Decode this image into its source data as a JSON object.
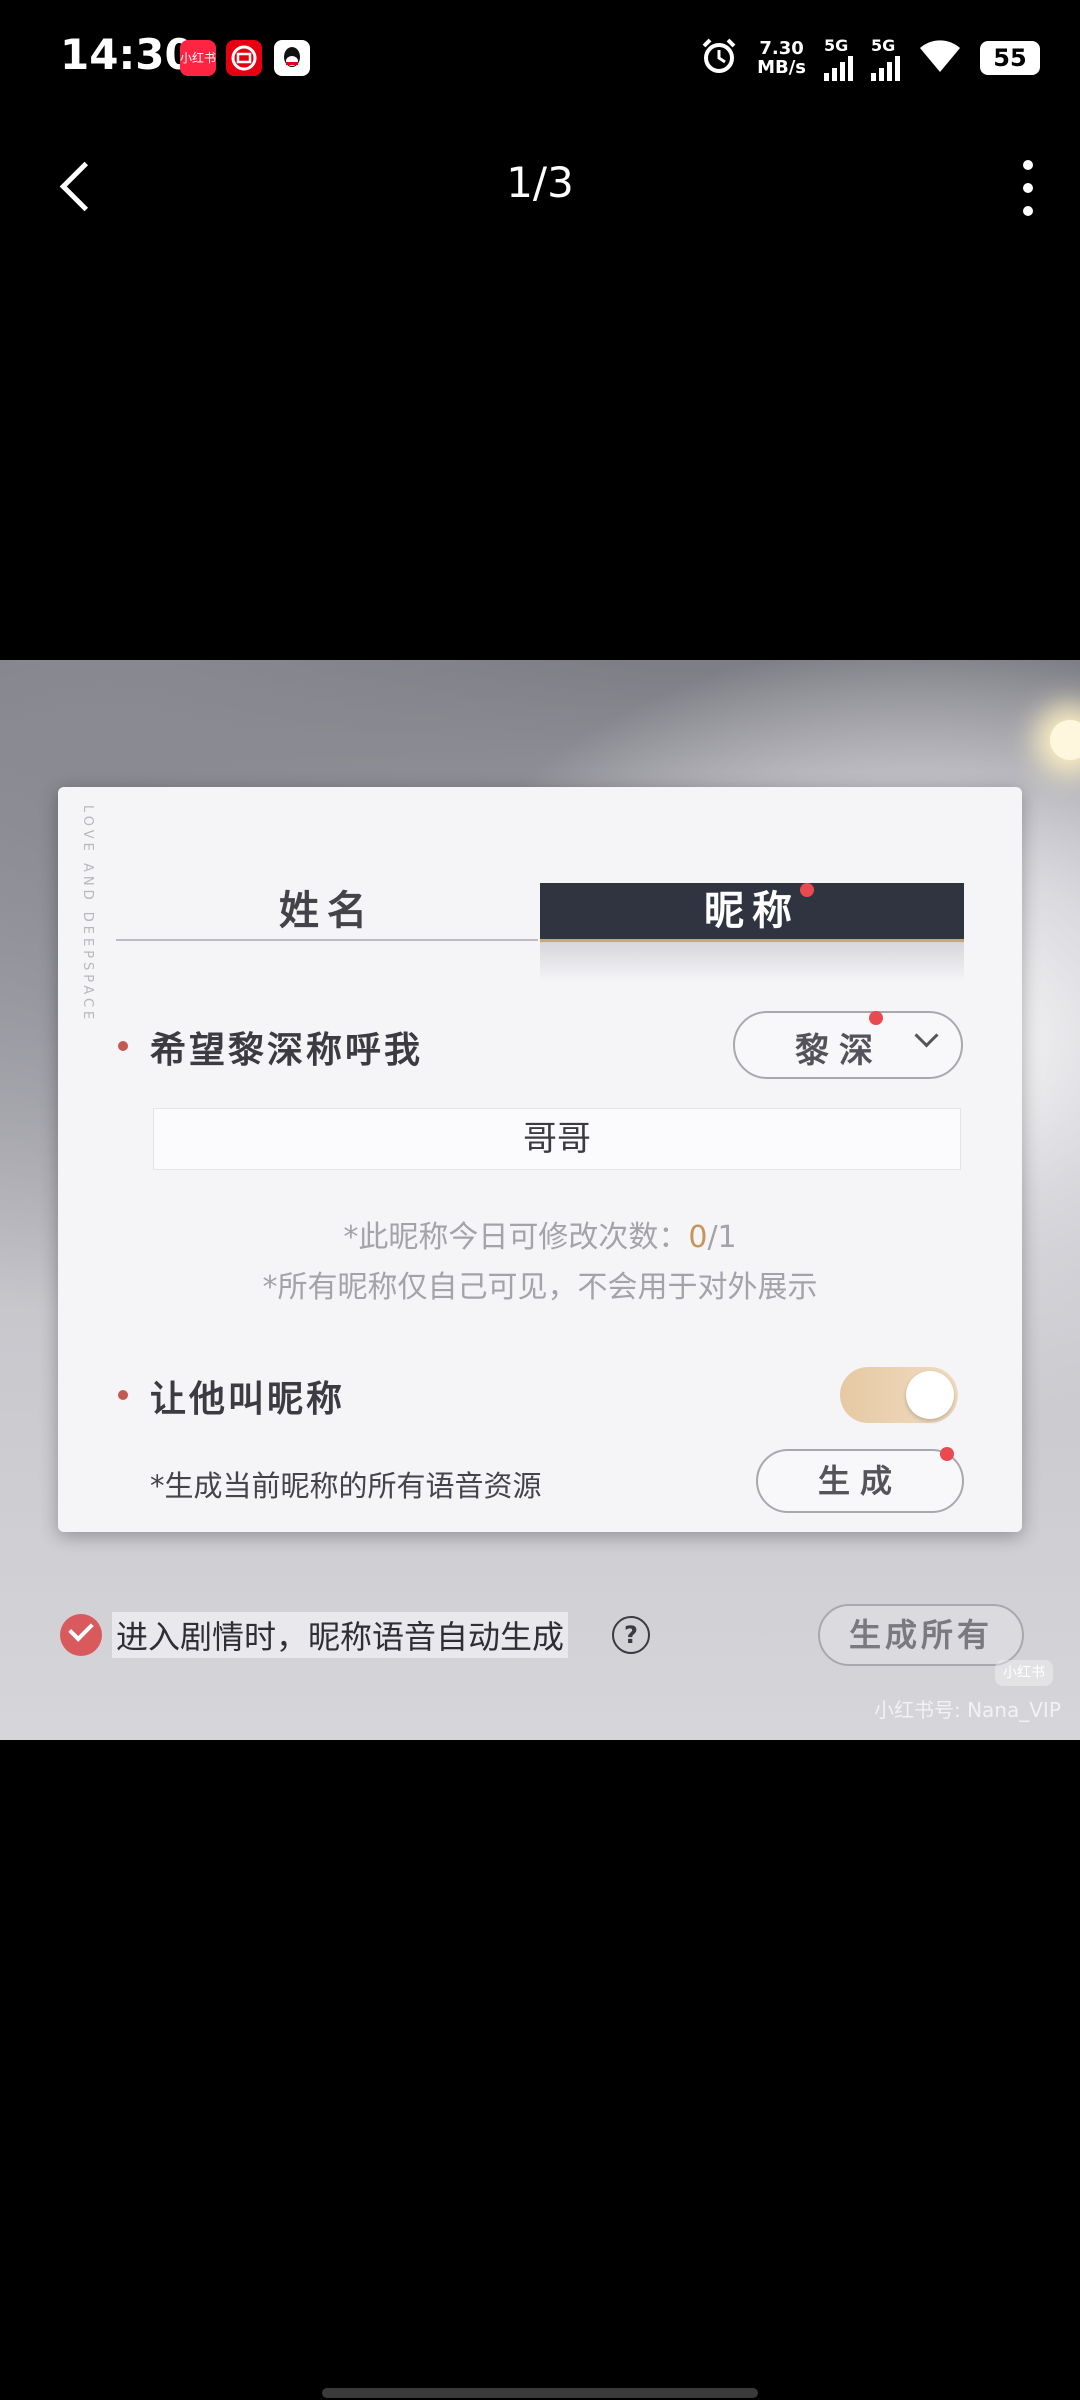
{
  "status_bar": {
    "time": "14:30",
    "apps": [
      {
        "name": "xiaohongshu-icon",
        "text": "小红书",
        "color": "#ff2442"
      },
      {
        "name": "bank-icon",
        "text": "",
        "color": "#e60012"
      },
      {
        "name": "qq-icon",
        "text": "",
        "color": "#ffffff"
      }
    ],
    "net_speed_value": "7.30",
    "net_speed_unit": "MB/s",
    "sim1": "5G",
    "sim2": "5G",
    "battery": "55"
  },
  "nav": {
    "page_indicator": "1/3"
  },
  "game": {
    "side_deco": "LOVE AND DEEPSPACE",
    "tabs": {
      "name": "姓名",
      "nickname": "昵称"
    },
    "call_me_label": "希望黎深称呼我",
    "character_select": "黎深",
    "nickname_value": "哥哥",
    "hint_change_prefix": "*此昵称今日可修改次数：",
    "hint_change_count": "0",
    "hint_change_total": "/1",
    "hint_visibility": "*所有昵称仅自己可见，不会用于对外展示",
    "let_him_call_label": "让他叫昵称",
    "toggle_on": true,
    "generate_desc": "*生成当前昵称的所有语音资源",
    "generate_button": "生成",
    "auto_generate_label": "进入剧情时，昵称语音自动生成",
    "help": "?",
    "generate_all_button": "生成所有"
  },
  "watermark": {
    "logo": "小红书",
    "id": "小红书号: Nana_VIP"
  },
  "colors": {
    "accent_dot": "#e84a4f",
    "tab_active_bg": "#2f3440",
    "toggle": "#e6c9a4",
    "count_highlight": "#c5955a"
  }
}
